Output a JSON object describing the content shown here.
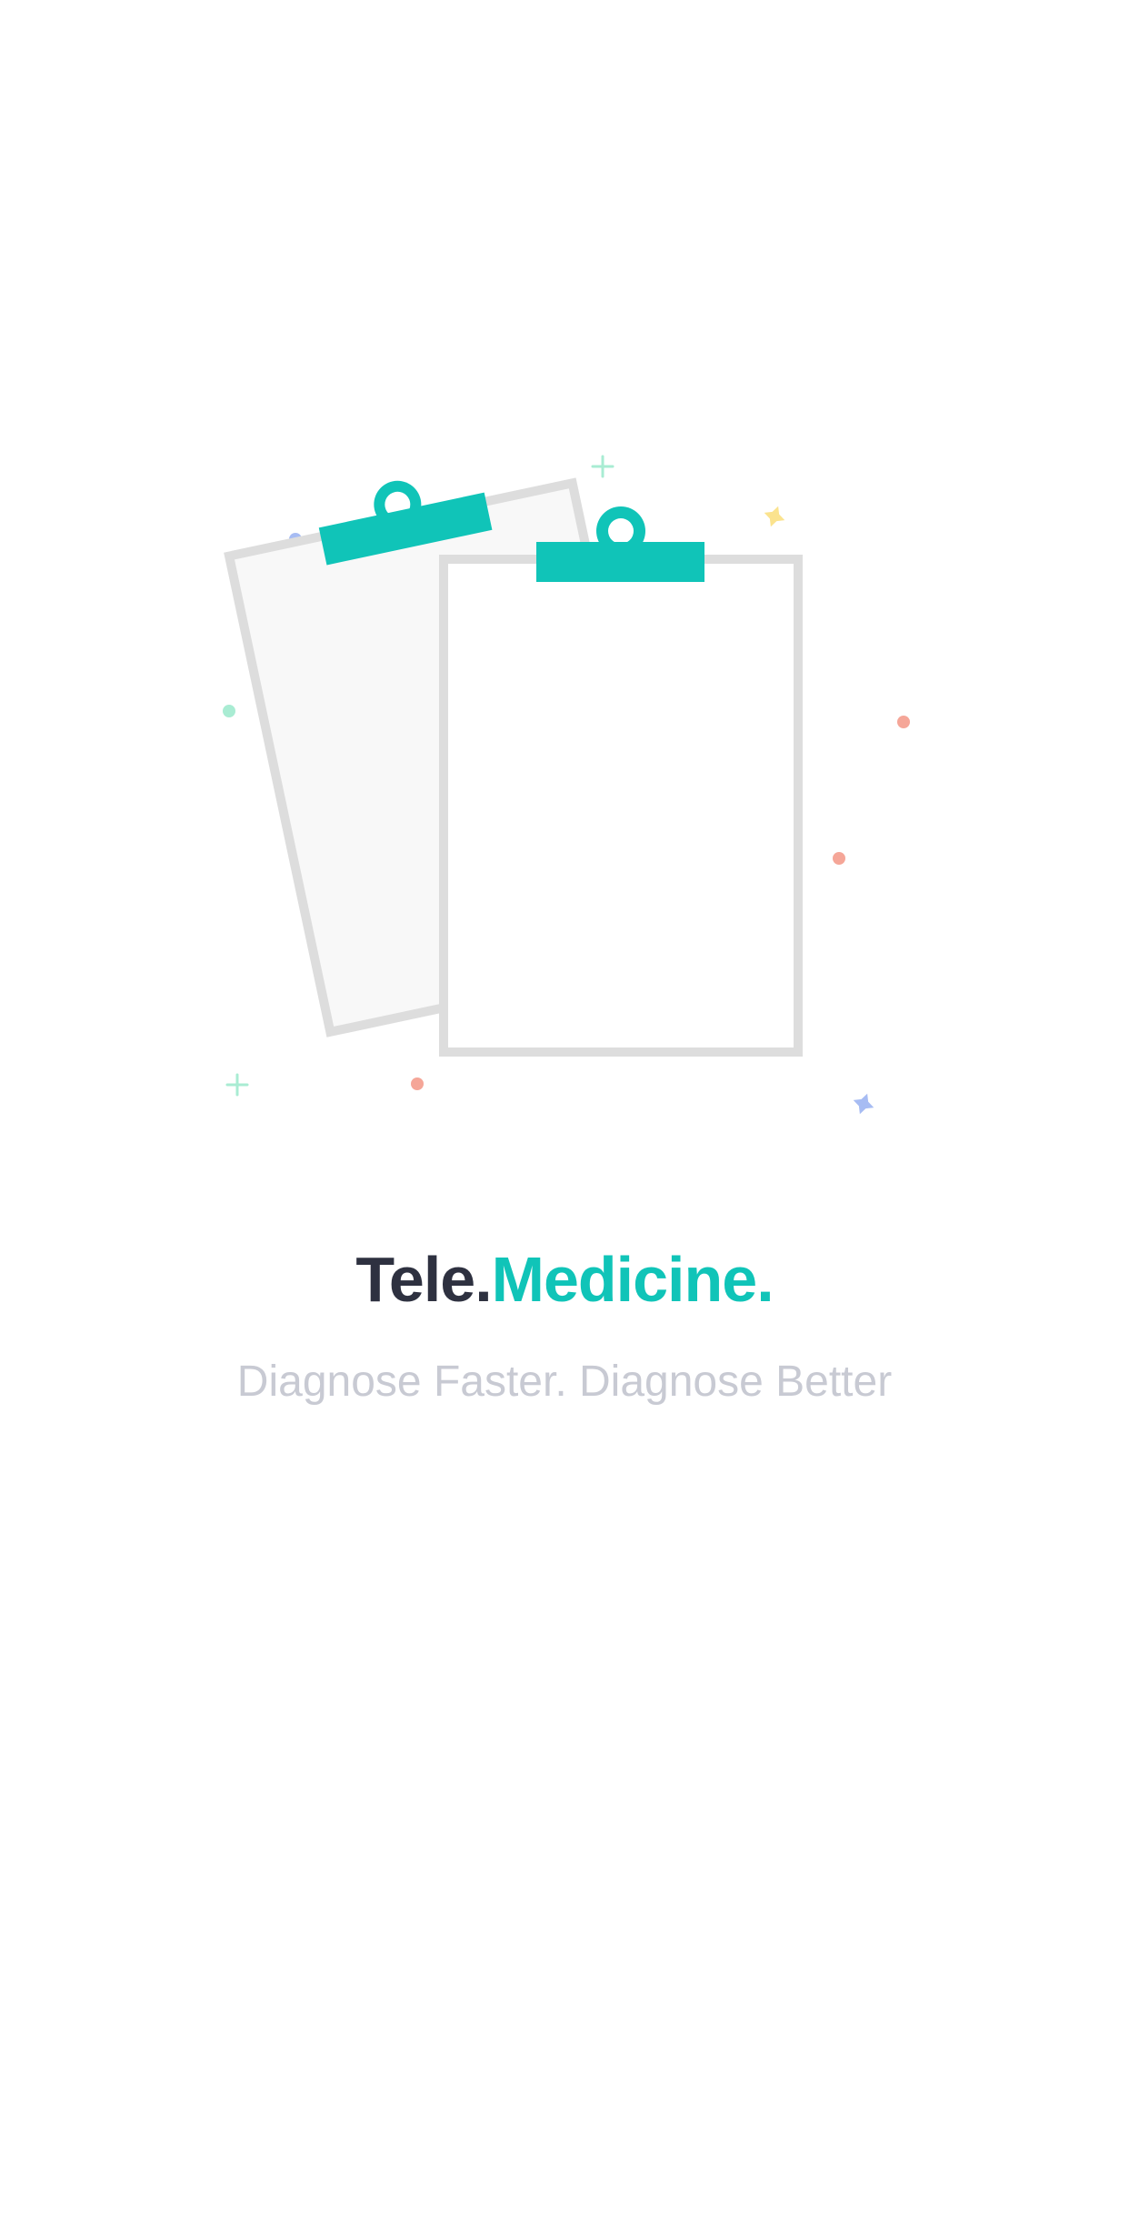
{
  "splash": {
    "brand_part1": "Tele.",
    "brand_part2": "Medicine.",
    "tagline": "Diagnose Faster. Diagnose Better"
  },
  "illustration": {
    "subject": "two clipboards",
    "icons": [
      "clipboard-back-icon",
      "clipboard-front-icon",
      "sparkle-plus-icon",
      "sparkle-star-icon",
      "dot-icon"
    ]
  },
  "colors": {
    "accent": "#10c4b8",
    "dark": "#2e3140",
    "tagline": "#c8cad3",
    "clipboard_border": "#dddddd",
    "paper_back": "#f8f8f8",
    "paper_front": "#ffffff",
    "dot_blue": "#a7bcf3",
    "dot_green": "#a9ecd3",
    "dot_red": "#f5a698",
    "sparkle_yellow": "#fbe38e",
    "sparkle_green": "#a9ecd3",
    "sparkle_blue": "#a7bcf3"
  }
}
